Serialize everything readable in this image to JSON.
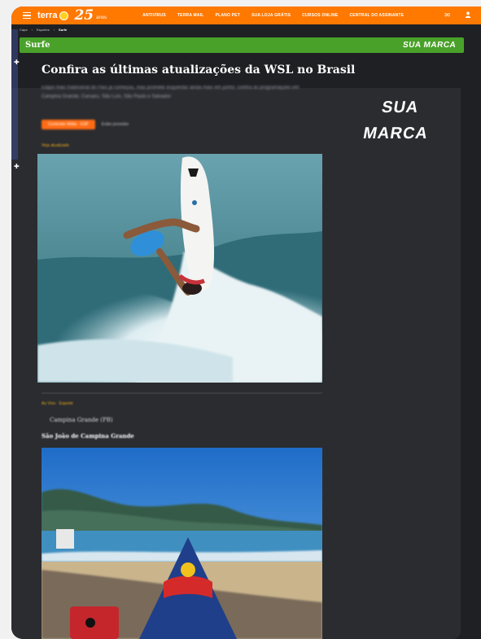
{
  "header": {
    "logo_text": "terra",
    "logo_number": "25",
    "logo_anos": "anos",
    "nav": [
      "ANTIVÍRUS",
      "TERRA MAIL",
      "PLANO PET",
      "SUA LOJA GRÁTIS",
      "CURSOS ONLINE",
      "CENTRAL DO ASSINANTE"
    ],
    "brand_color": "#ff7800"
  },
  "breadcrumb": [
    "Capa",
    "Esportes",
    "Surfe"
  ],
  "section": {
    "title": "Surfe",
    "brand": "SUA MARCA",
    "color": "#4aa12a"
  },
  "article": {
    "headline": "Confira as últimas atualizações da WSL no Brasil",
    "description": "Etapa mais tradicional do País já começou, mas promete esquentar ainda mais em junho; confira as programações em Campina Grande, Caruaru, São Luís, São Paulo e Salvador",
    "tag_primary": "Conteúdo Mídia · ESP",
    "tag_secondary": "Exibe provedor",
    "see_more": "Veja atualizado",
    "live_label": "Ao Vivo · Esporte",
    "location": "Campina Grande (PB)",
    "subtitle": "São João de Campina Grande"
  },
  "side_brand": {
    "line1": "SUA",
    "line2": "MARCA"
  },
  "icons": [
    "menu-icon",
    "mail-icon",
    "user-icon"
  ]
}
